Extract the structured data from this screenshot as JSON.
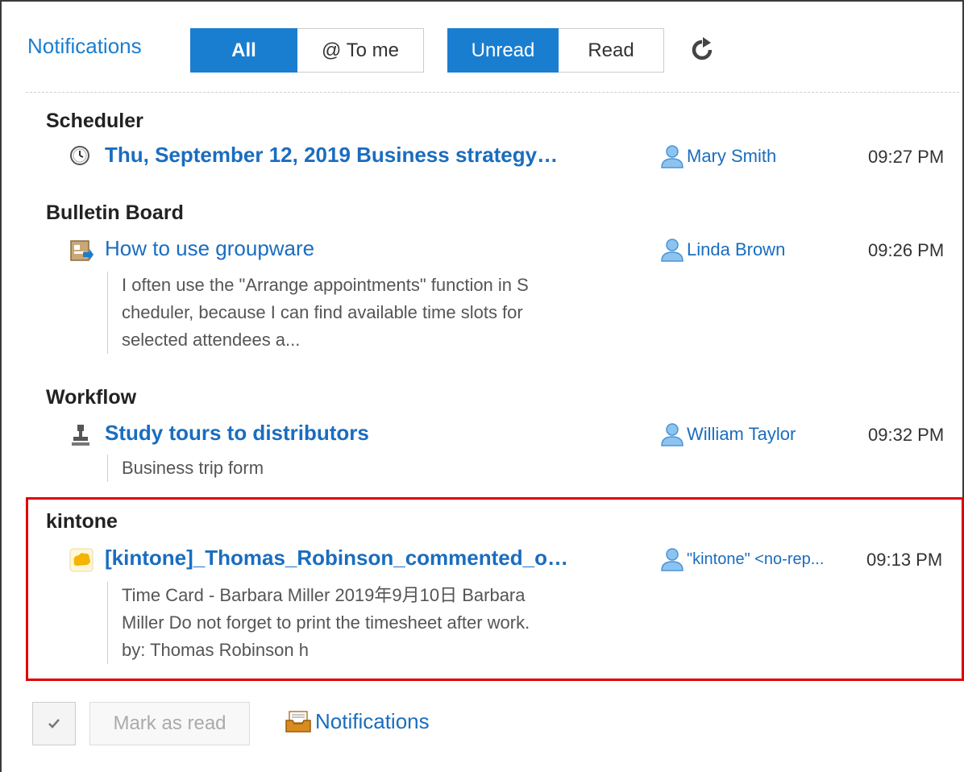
{
  "header": {
    "title": "Notifications",
    "filter_all": "All",
    "filter_to_me": "@ To me",
    "filter_unread": "Unread",
    "filter_read": "Read",
    "accent": "#1a7ed0"
  },
  "sections": [
    {
      "title": "Scheduler",
      "item": {
        "icon": "clock-icon",
        "subject": "Thu, September 12, 2019 Business strategy…",
        "user": "Mary Smith",
        "time": "09:27 PM"
      }
    },
    {
      "title": "Bulletin Board",
      "item": {
        "icon": "bulletin-board-icon",
        "subject": "How to use groupware",
        "user": "Linda Brown",
        "time": "09:26 PM",
        "excerpt": [
          "I often use the \"Arrange appointments\" function in S",
          "cheduler, because I can find available time slots for",
          "selected attendees a..."
        ]
      }
    },
    {
      "title": "Workflow",
      "item": {
        "icon": "workflow-stamp-icon",
        "subject": "Study tours to distributors",
        "user": "William Taylor",
        "time": "09:32 PM",
        "excerpt": [
          "Business trip form"
        ]
      }
    },
    {
      "title": "kintone",
      "item": {
        "icon": "kintone-icon",
        "subject": "[kintone]_Thomas_Robinson_commented_o…",
        "user": "\"kintone\" <no-rep...",
        "time": "09:13 PM",
        "excerpt": [
          "Time Card - Barbara Miller 2019年9月10日 Barbara",
          "Miller Do not forget to print the timesheet after work.",
          "by: Thomas Robinson h"
        ]
      }
    }
  ],
  "footer": {
    "mark_as_read": "Mark as read",
    "notifications_link": "Notifications"
  },
  "colors": {
    "link": "#1a6dbf",
    "highlight": "#e00000"
  }
}
